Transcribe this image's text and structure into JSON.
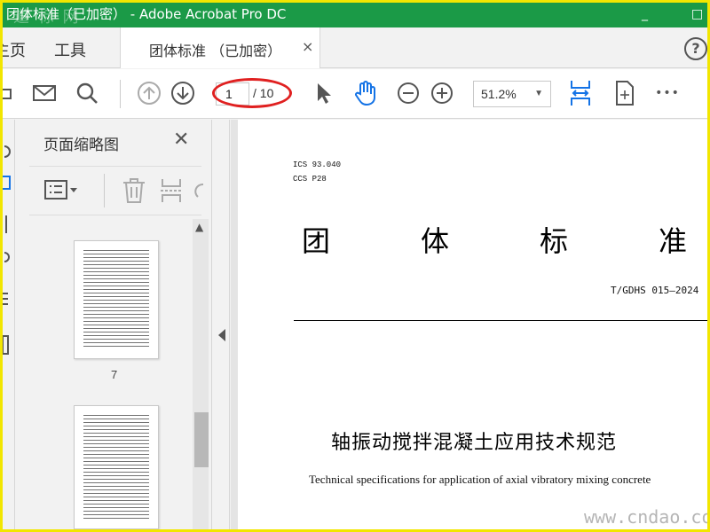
{
  "window": {
    "title": "团体标准（已加密） - Adobe Acrobat Pro DC",
    "watermark_top": "道 标 网",
    "controls": {
      "minimize": "_",
      "maximize": "□"
    }
  },
  "tabs": {
    "home_label": "主页",
    "tools_label": "工具",
    "document_tab_label": "团体标准 （已加密）",
    "close_glyph": "×",
    "help_glyph": "?"
  },
  "toolbar": {
    "current_page": "1",
    "page_total": "/ 10",
    "zoom": "51.2%",
    "more_glyph": "•••"
  },
  "panel": {
    "title": "页面缩略图",
    "close_glyph": "✕",
    "thumbnails": [
      {
        "page_label": "7"
      },
      {
        "page_label": ""
      }
    ]
  },
  "document": {
    "ics": "ICS 93.040",
    "ccs": "CCS P28",
    "title_chars": [
      "团",
      "体",
      "标",
      "准"
    ],
    "standard_no": "T/GDHS 015—2024",
    "title_zh": "轴振动搅拌混凝土应用技术规范",
    "title_en": "Technical specifications for application of axial vibratory mixing concrete"
  },
  "watermark_bottom": "www.cndao.com",
  "colors": {
    "titlebar": "#1b9a47",
    "accent_blue": "#1473e6",
    "highlight_oval": "#e02020",
    "frame": "#f2e600"
  }
}
